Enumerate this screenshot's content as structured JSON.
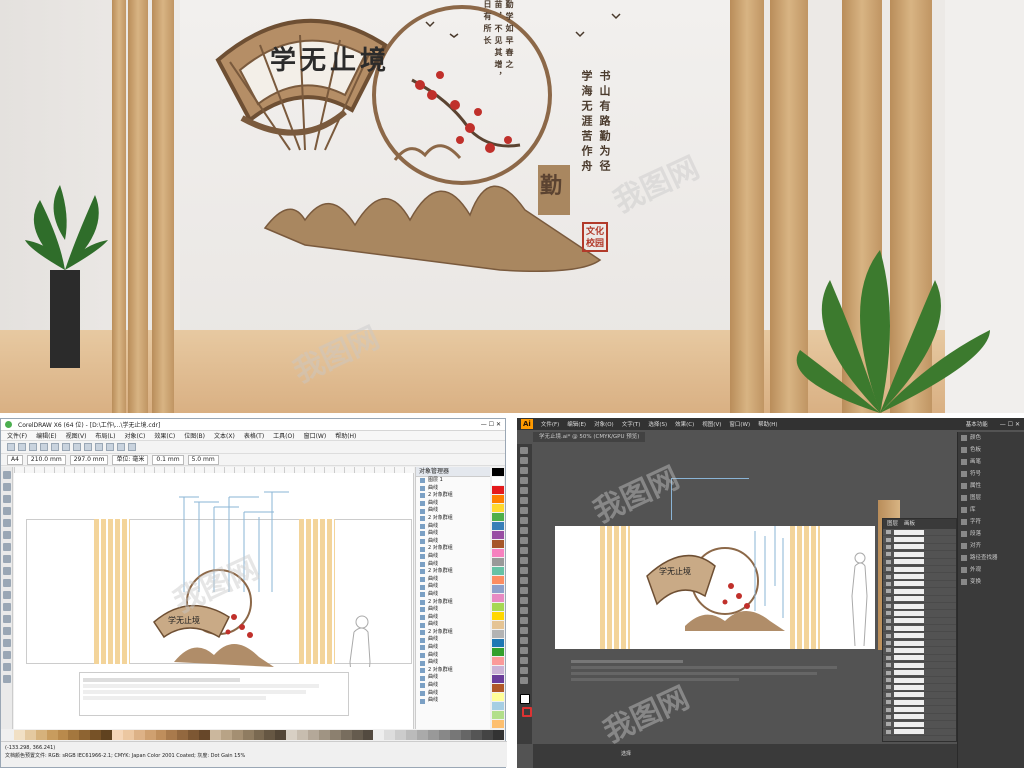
{
  "top_render": {
    "title": "学无止境",
    "poem_left": "勤学如早春之苗，不见其增，日有所长",
    "poem_right_col1": "书山有路勤为径",
    "poem_right_col2": "学海无涯苦作舟",
    "seal_text": "文化校园",
    "tall_char": "勤"
  },
  "corel": {
    "title": "CorelDRAW X6 (64 位) - [D:\\工作\\...\\学无止境.cdr]",
    "menu": [
      "文件(F)",
      "编辑(E)",
      "视图(V)",
      "布局(L)",
      "对象(C)",
      "效果(C)",
      "位图(B)",
      "文本(X)",
      "表格(T)",
      "工具(O)",
      "窗口(W)",
      "帮助(H)"
    ],
    "prop_fields": [
      "A4",
      "210.0 mm",
      "297.0 mm",
      "单位: 毫米",
      "0.1 mm",
      "5.0 mm"
    ],
    "panel_title": "对象管理器",
    "panel_rows": [
      "图层 1",
      "曲线",
      "2 对象群组",
      "曲线",
      "曲线",
      "2 对象群组",
      "曲线",
      "曲线",
      "曲线",
      "2 对象群组",
      "曲线",
      "曲线",
      "2 对象群组",
      "曲线",
      "曲线",
      "曲线",
      "2 对象群组",
      "曲线",
      "曲线",
      "曲线",
      "2 对象群组",
      "曲线",
      "曲线",
      "曲线",
      "曲线",
      "2 对象群组",
      "曲线",
      "曲线",
      "曲线",
      "曲线"
    ],
    "status_line1": "(-133.298, 366.241)",
    "status_line2": "文档颜色预置文件: RGB: sRGB IEC61966-2.1; CMYK: Japan Color 2001 Coated; 灰度: Dot Gain 15%"
  },
  "illustrator": {
    "logo": "Ai",
    "menu": [
      "文件(F)",
      "编辑(E)",
      "对象(O)",
      "文字(T)",
      "选择(S)",
      "效果(C)",
      "视图(V)",
      "窗口(W)",
      "帮助(H)"
    ],
    "workspace": "基本功能",
    "doc_tab": "学无止境.ai* @ 50% (CMYK/GPU 预览)",
    "right_panel": [
      "颜色",
      "色板",
      "画笔",
      "符号",
      "属性",
      "图层",
      "库",
      "字符",
      "段落",
      "对齐",
      "路径查找器",
      "外观",
      "变换"
    ],
    "layers_tabs": [
      "图层",
      "画板"
    ],
    "status": "选择"
  },
  "watermark": "我图网"
}
